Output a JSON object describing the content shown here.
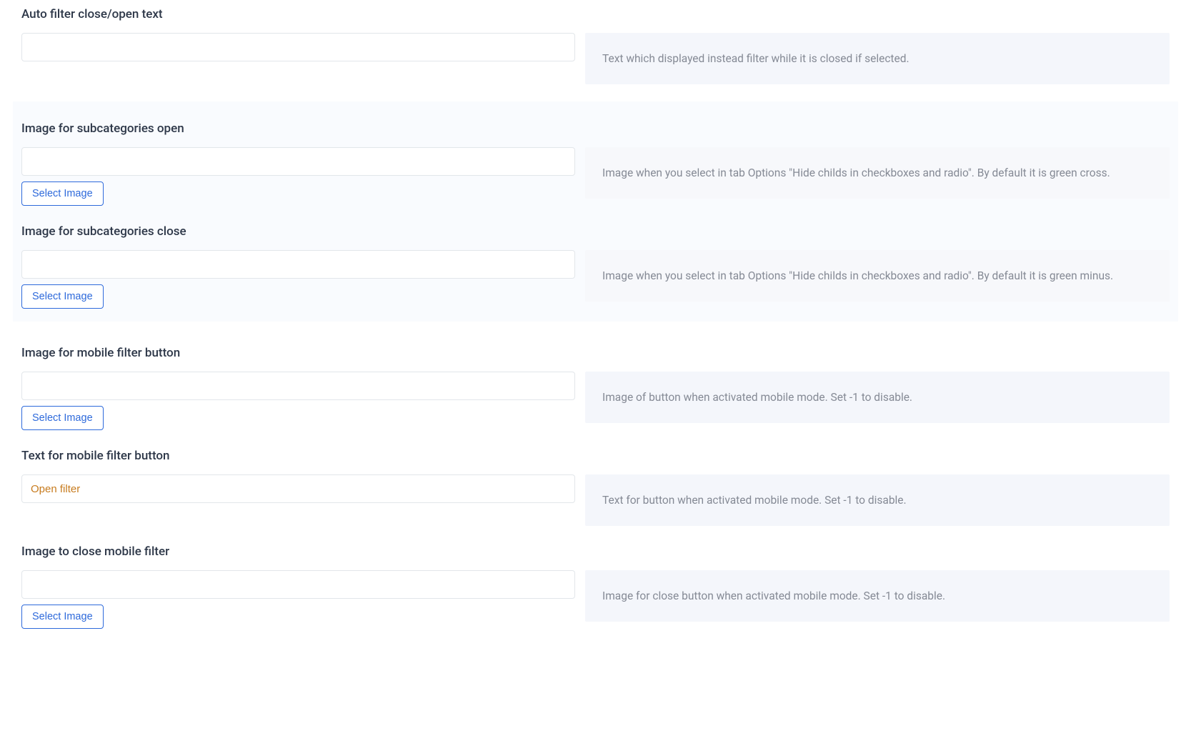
{
  "buttons": {
    "select_image": "Select Image"
  },
  "fields": {
    "auto_filter_text": {
      "label": "Auto filter close/open text",
      "value": "",
      "desc": "Text which displayed instead filter while it is closed if selected."
    },
    "img_sub_open": {
      "label": "Image for subcategories open",
      "value": "",
      "desc": "Image when you select in tab Options \"Hide childs in checkboxes and radio\". By default it is green cross."
    },
    "img_sub_close": {
      "label": "Image for subcategories close",
      "value": "",
      "desc": "Image when you select in tab Options \"Hide childs in checkboxes and radio\". By default it is green minus."
    },
    "img_mobile_btn": {
      "label": "Image for mobile filter button",
      "value": "",
      "desc": "Image of button when activated mobile mode. Set -1 to disable."
    },
    "text_mobile_btn": {
      "label": "Text for mobile filter button",
      "value": "Open filter",
      "desc": "Text for button when activated mobile mode. Set -1 to disable."
    },
    "img_close_mobile": {
      "label": "Image to close mobile filter",
      "value": "",
      "desc": "Image for close button when activated mobile mode. Set -1 to disable."
    }
  }
}
